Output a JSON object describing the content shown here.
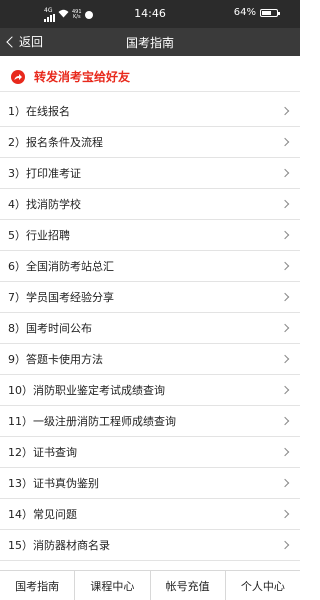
{
  "statusbar": {
    "network": "4G",
    "speed_value": "491",
    "speed_unit": "K/s",
    "time": "14:46",
    "battery_percent": "64%",
    "battery_level": 0.64
  },
  "navbar": {
    "back_label": "返回",
    "title": "国考指南"
  },
  "share": {
    "label": "转发消考宝给好友"
  },
  "menu": {
    "items": [
      {
        "label": "1）在线报名"
      },
      {
        "label": "2）报名条件及流程"
      },
      {
        "label": "3）打印准考证"
      },
      {
        "label": "4）找消防学校"
      },
      {
        "label": "5）行业招聘"
      },
      {
        "label": "6）全国消防考站总汇"
      },
      {
        "label": "7）学员国考经验分享"
      },
      {
        "label": "8）国考时间公布"
      },
      {
        "label": "9）答题卡使用方法"
      },
      {
        "label": "10）消防职业鉴定考试成绩查询"
      },
      {
        "label": "11）一级注册消防工程师成绩查询"
      },
      {
        "label": "12）证书查询"
      },
      {
        "label": "13）证书真伪鉴别"
      },
      {
        "label": "14）常见问题"
      },
      {
        "label": "15）消防器材商名录"
      }
    ]
  },
  "tabbar": {
    "tabs": [
      {
        "label": "国考指南"
      },
      {
        "label": "课程中心"
      },
      {
        "label": "帐号充值"
      },
      {
        "label": "个人中心"
      }
    ]
  },
  "colors": {
    "accent_red": "#e8291c",
    "header_bg": "#3a3a3a",
    "statusbar_bg": "#2b2b2b"
  }
}
